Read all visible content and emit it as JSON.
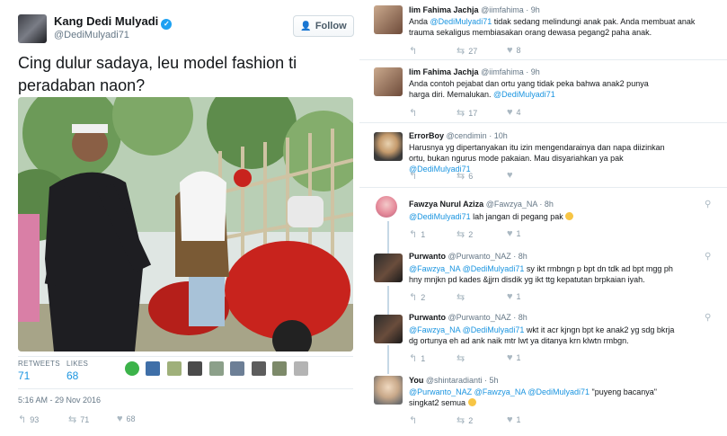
{
  "main_tweet": {
    "author_name": "Kang Dedi Mulyadi",
    "author_handle": "@DediMulyadi71",
    "follow_label": "Follow",
    "text": "Cing dulur sadaya, leu model fashion ti peradaban naon?",
    "retweets_label": "RETWEETS",
    "retweets": "71",
    "likes_label": "LIKES",
    "likes": "68",
    "timestamp": "5:16 AM - 29 Nov 2016",
    "actions": {
      "replies": "93",
      "retweets": "71",
      "likes": "68"
    }
  },
  "replies": [
    {
      "name": "Iim Fahima Jachja",
      "handle": "@iimfahima",
      "time": "· 9h",
      "text_a": "Anda ",
      "mention_a": "@DediMulyadi71",
      "text_b": " tidak sedang melindungi anak pak. Anda membuat anak trauma sekaligus membiasakan orang dewasa pegang2 paha anak.",
      "retweets": "27",
      "likes": "8"
    },
    {
      "name": "Iim Fahima Jachja",
      "handle": "@iimfahima",
      "time": "· 9h",
      "text_a": "Anda contoh pejabat dan ortu yang tidak peka bahwa anak2 punya harga diri. Memalukan. ",
      "mention_a": "@DediMulyadi71",
      "text_b": "",
      "retweets": "17",
      "likes": "4"
    },
    {
      "name": "ErrorBoy",
      "handle": "@cendimin",
      "time": "· 10h",
      "text_a": "Harusnya yg dipertanyakan itu izin mengendarainya dan napa diizinkan ortu, bukan ngurus mode pakaian. Mau disyariahkan ya pak ",
      "mention_a": "@DediMulyadi71",
      "text_b": "",
      "retweets": "6",
      "likes": ""
    },
    {
      "name": "Fawzya Nurul Aziza",
      "handle": "@Fawzya_NA",
      "time": "· 8h",
      "text_a": "",
      "mention_a": "@DediMulyadi71",
      "text_b": " lah jangan di pegang pak ",
      "replies": "1",
      "retweets": "2",
      "likes": "1"
    },
    {
      "name": "Purwanto",
      "handle": "@Purwanto_NAZ",
      "time": "· 8h",
      "text_a": "",
      "mention_a": "@Fawzya_NA @DediMulyadi71",
      "text_b": " sy ikt rmbngn p bpt dn tdk ad bpt mgg ph hny mnjkn pd kades &jjrn disdik yg ikt ttg kepatutan brpkaian iyah.",
      "replies": "2",
      "retweets": "",
      "likes": "1"
    },
    {
      "name": "Purwanto",
      "handle": "@Purwanto_NAZ",
      "time": "· 8h",
      "text_a": "",
      "mention_a": "@Fawzya_NA @DediMulyadi71",
      "text_b": " wkt it acr kjngn bpt ke anak2 yg sdg bkrja dg ortunya eh ad ank naik mtr lwt ya ditanya krn klwtn rmbgn.",
      "replies": "1",
      "retweets": "",
      "likes": "1"
    },
    {
      "name": "You",
      "handle": "@shintaradianti",
      "time": "· 5h",
      "text_a": "",
      "mention_a": "@Purwanto_NAZ @Fawzya_NA @DediMulyadi71",
      "text_b": " \"puyeng bacanya\" singkat2 semua ",
      "replies": "",
      "retweets": "2",
      "likes": "1"
    }
  ],
  "icons": {
    "reply": "reply-icon",
    "retweet": "retweet-icon",
    "like": "heart-icon",
    "location": "location-pin-icon",
    "verified": "verified-badge-icon"
  },
  "colors": {
    "accent": "#1da1f2",
    "link": "#1b95e0",
    "muted": "#657786",
    "border": "#e6ecf0",
    "thread": "#c6d8e6"
  }
}
